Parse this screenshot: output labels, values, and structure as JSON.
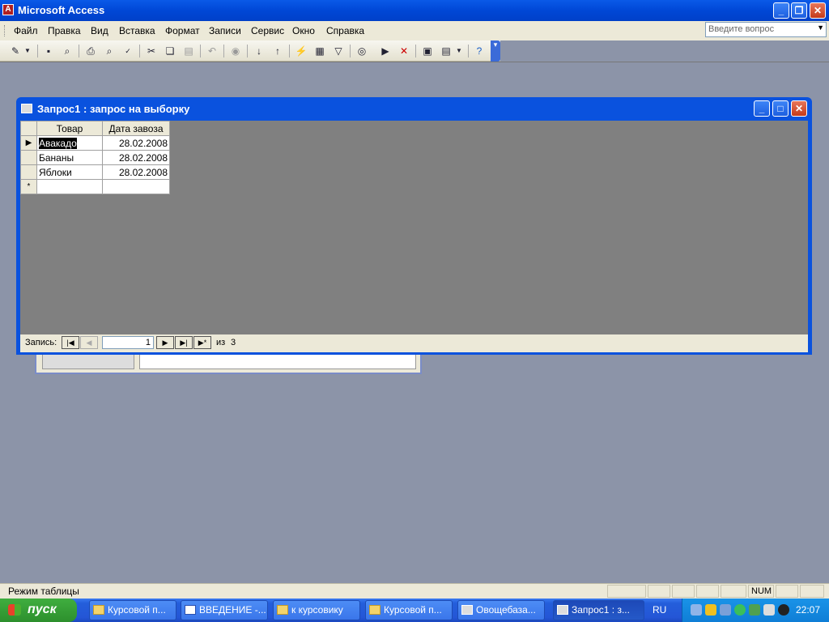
{
  "app": {
    "title": "Microsoft Access"
  },
  "menu": {
    "items": [
      "Файл",
      "Правка",
      "Вид",
      "Вставка",
      "Формат",
      "Записи",
      "Сервис",
      "Окно",
      "Справка"
    ],
    "ask_placeholder": "Введите вопрос"
  },
  "query_window": {
    "title": "Запрос1 : запрос на выборку",
    "columns": [
      "Товар",
      "Дата завоза"
    ],
    "rows": [
      {
        "product": "Авакадо",
        "date": "28.02.2008"
      },
      {
        "product": "Бананы",
        "date": "28.02.2008"
      },
      {
        "product": "Яблоки",
        "date": "28.02.2008"
      }
    ],
    "new_row_marker": "*",
    "nav": {
      "label": "Запись:",
      "current": "1",
      "of_label": "из",
      "total": "3"
    }
  },
  "statusbar": {
    "mode": "Режим таблицы",
    "num": "NUM"
  },
  "taskbar": {
    "start_label": "пуск",
    "tasks": [
      "Курсовой п...",
      "ВВЕДЕНИЕ -...",
      "к курсовику",
      "Курсовой п...",
      "Овощебаза...",
      "Запрос1 : з..."
    ],
    "lang": "RU",
    "clock": "22:07"
  },
  "colors": {
    "titlebar": "#0a52de",
    "workspace": "#8c94a8",
    "datasheet_bg": "#808080",
    "taskbar": "#245edb"
  }
}
